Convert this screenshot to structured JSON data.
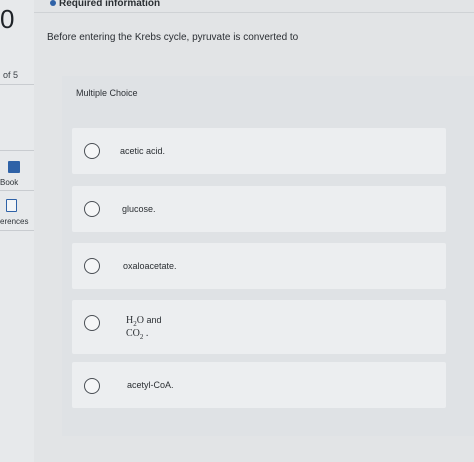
{
  "sidebar": {
    "question_number": "0",
    "question_of": "of 5",
    "book_label": "Book",
    "references_label": "erences"
  },
  "header": {
    "required_information": "Required information"
  },
  "question": {
    "prompt": "Before entering the Krebs cycle, pyruvate is converted to",
    "type_label": "Multiple Choice"
  },
  "options": [
    {
      "text": "acetic acid."
    },
    {
      "text": "glucose."
    },
    {
      "text": "oxaloacetate."
    },
    {
      "formula1": "H",
      "sub1": "2",
      "rest1": "O",
      "joiner": "and",
      "formula2": "CO",
      "sub2": "2",
      "rest2": "."
    },
    {
      "text": "acetyl-CoA."
    }
  ],
  "colors": {
    "accent": "#2f62a7",
    "background": "#e2e4e6",
    "option_background": "#eceef0"
  }
}
